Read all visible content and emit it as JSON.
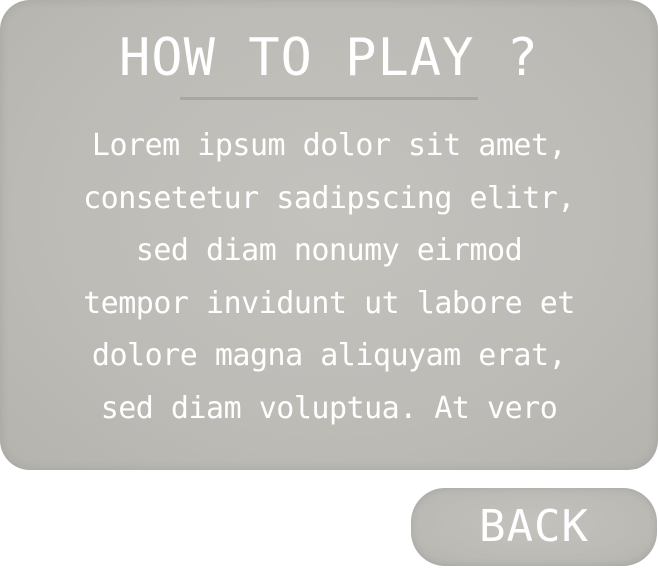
{
  "dialog": {
    "title": "HOW TO PLAY ?",
    "body_lines": [
      "Lorem ipsum dolor sit amet,",
      "consetetur sadipscing elitr,",
      "sed diam nonumy eirmod",
      "tempor invidunt ut labore et",
      "dolore magna aliquyam erat,",
      "sed diam voluptua. At vero"
    ]
  },
  "back_button": {
    "label": "BACK"
  },
  "colors": {
    "panel": "#bdbbb6",
    "divider": "#a9a7a2",
    "text": "#ffffff",
    "background": "#ffffff"
  }
}
